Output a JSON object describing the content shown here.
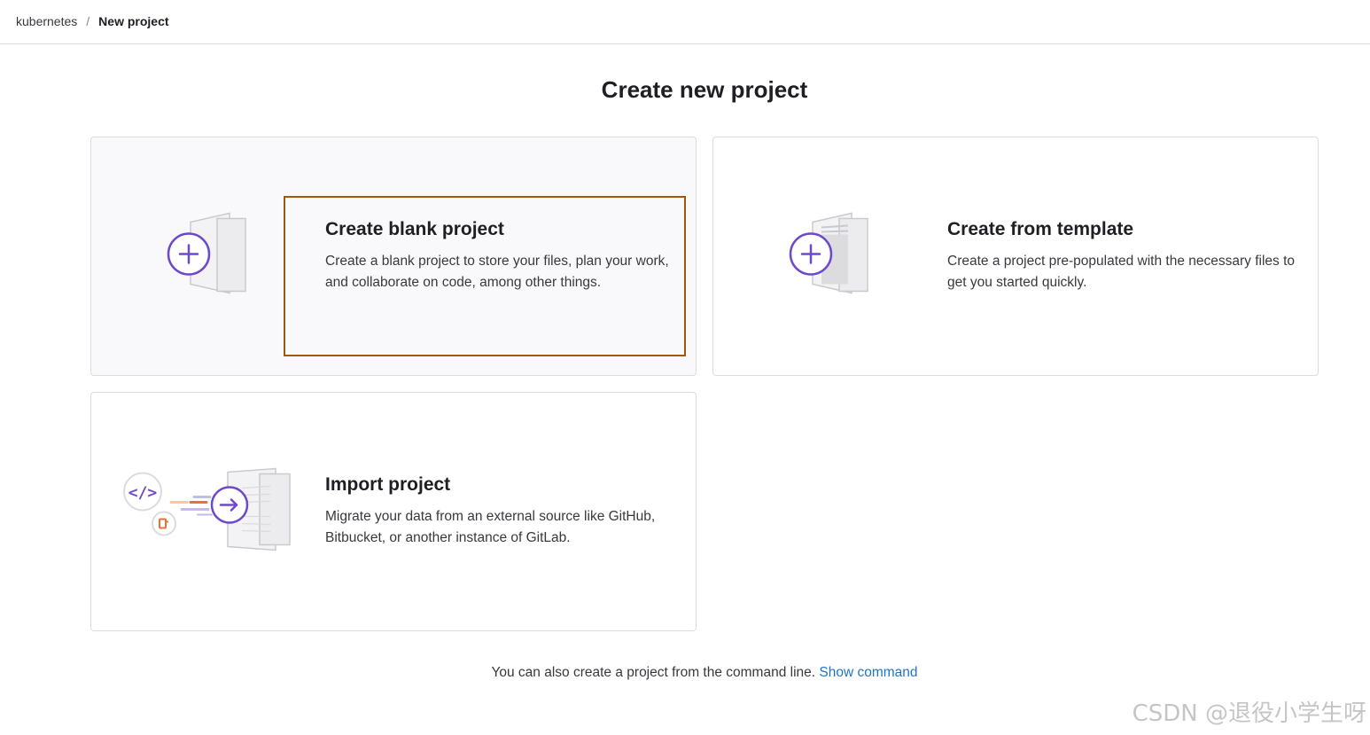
{
  "breadcrumb": {
    "parent": "kubernetes",
    "separator": "/",
    "current": "New project"
  },
  "page": {
    "title": "Create new project"
  },
  "cards": {
    "blank": {
      "title": "Create blank project",
      "description": "Create a blank project to store your files, plan your work, and collaborate on code, among other things.",
      "icon": "plus-document-icon"
    },
    "template": {
      "title": "Create from template",
      "description": "Create a project pre-populated with the necessary files to get you started quickly.",
      "icon": "plus-template-document-icon"
    },
    "import": {
      "title": "Import project",
      "description": "Migrate your data from an external source like GitHub, Bitbucket, or another instance of GitLab.",
      "icon": "import-arrow-document-icon"
    }
  },
  "footer": {
    "text": "You can also create a project from the command line.",
    "link_label": "Show command"
  },
  "watermark": "CSDN @退役小学生呀",
  "colors": {
    "accent_purple": "#6e49cb",
    "link_blue": "#1f75cb",
    "focus_outline": "#a0580d",
    "orange": "#e9703a"
  }
}
